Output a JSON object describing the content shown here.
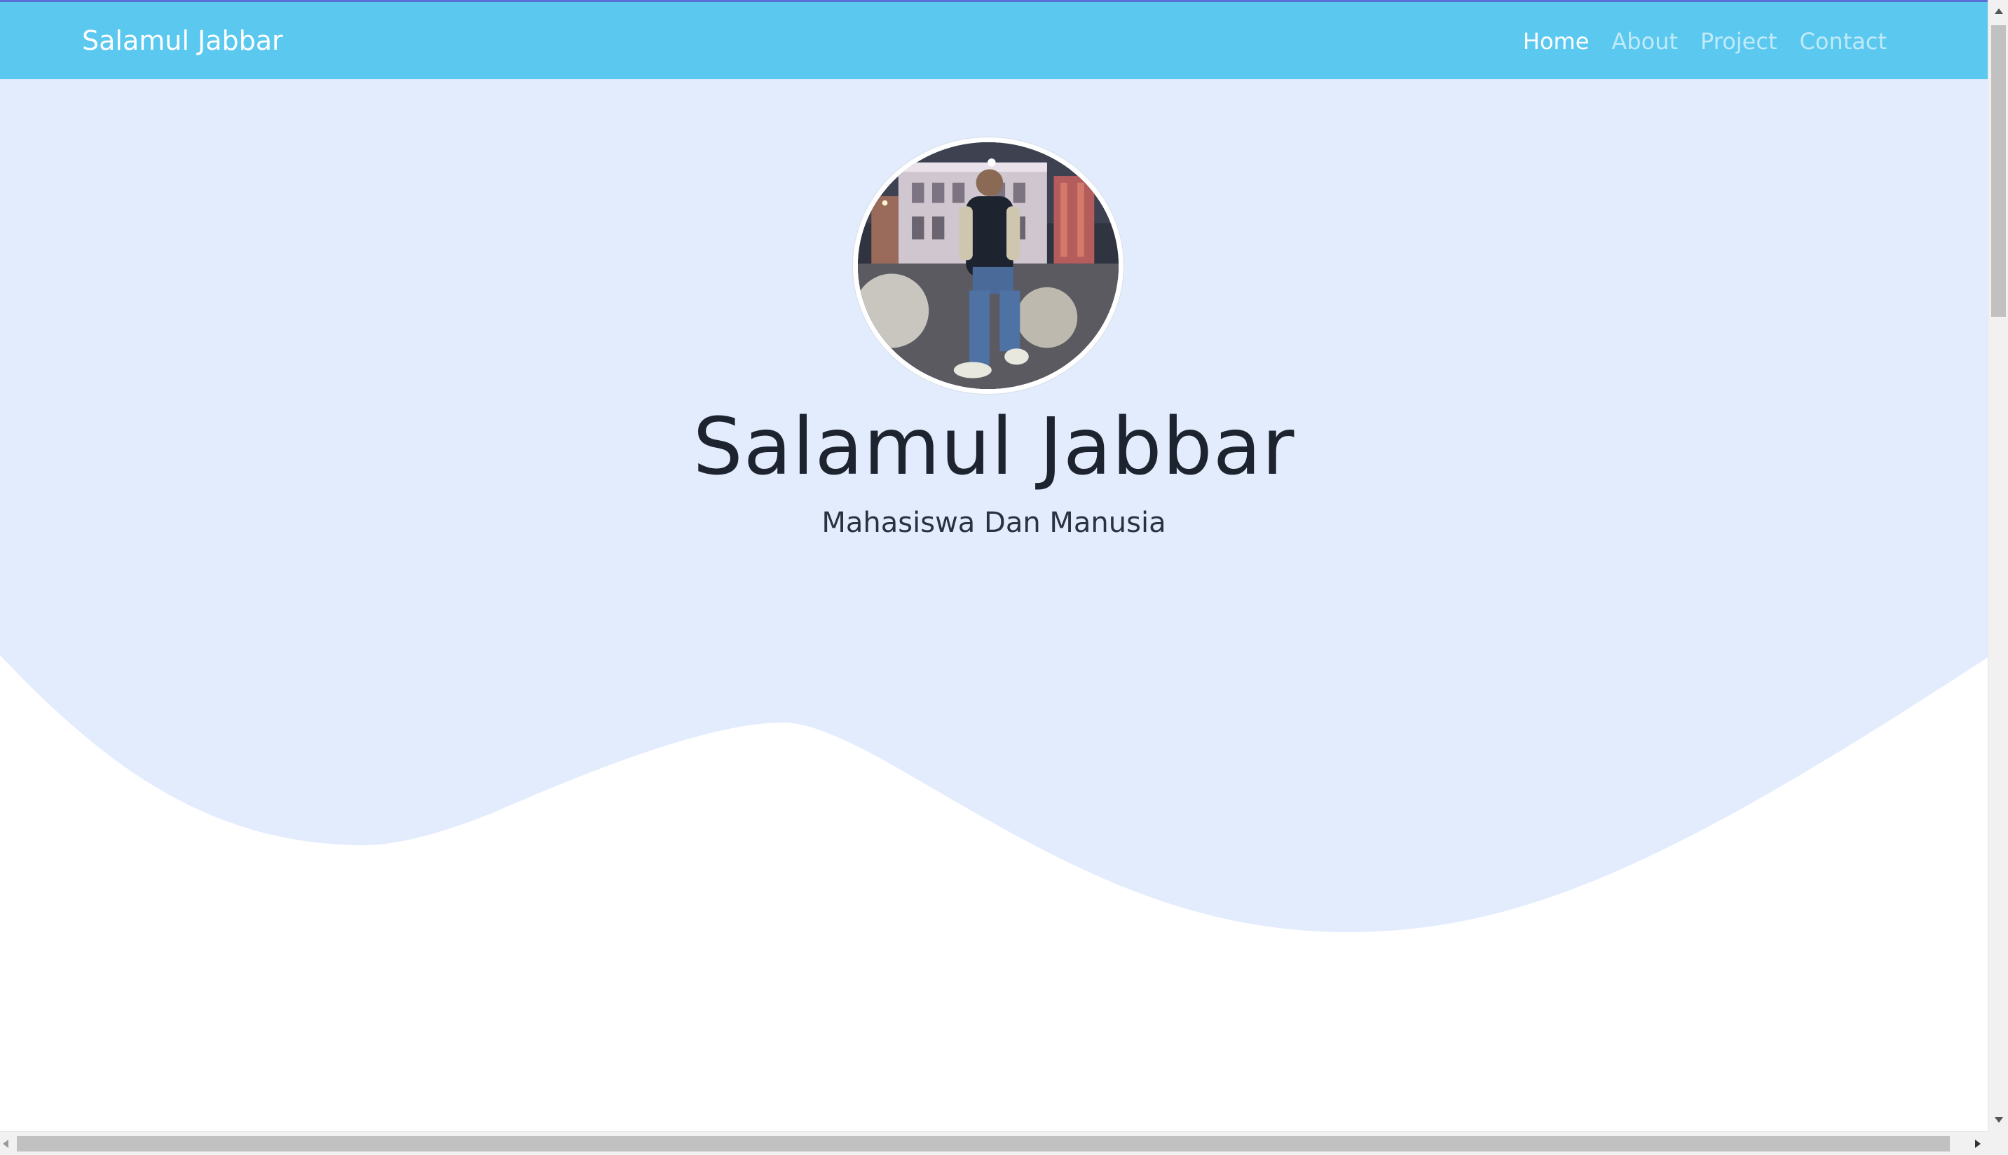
{
  "navbar": {
    "brand": "Salamul Jabbar",
    "links": [
      {
        "label": "Home",
        "active": true
      },
      {
        "label": "About",
        "active": false
      },
      {
        "label": "Project",
        "active": false
      },
      {
        "label": "Contact",
        "active": false
      }
    ]
  },
  "hero": {
    "title": "Salamul Jabbar",
    "subtitle": "Mahasiswa Dan Manusia"
  },
  "colors": {
    "navbar": "#5bc8ef",
    "hero_background": "#e3ecfd",
    "text_dark": "#1d2430"
  },
  "icons": {
    "avatar": "profile-photo"
  }
}
